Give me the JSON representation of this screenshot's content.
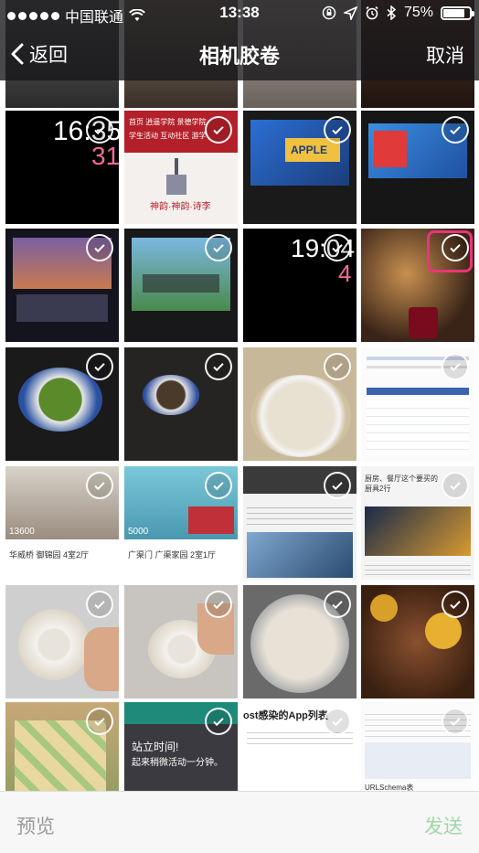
{
  "status_bar": {
    "carrier": "中国联通",
    "time": "13:38",
    "battery": "75%"
  },
  "nav": {
    "back_label": "返回",
    "title": "相机胶卷",
    "cancel_label": "取消"
  },
  "toolbar": {
    "preview_label": "预览",
    "send_label": "发送"
  },
  "photos": {
    "watch1_time": "16:35",
    "watch1_day": "31",
    "watch2_time": "19:04",
    "watch2_day": "4",
    "web_menu": "首页   逍遥学院   景德学院",
    "web_menu2": "学生活动   互动社区   游学",
    "web_caption": "神韵·神韵·诗李",
    "tv_brand": "APPLE",
    "house1_price": "13600",
    "house1_title": "华威桥  御锦园  4室2厅",
    "house2_price": "5000",
    "house2_title": "广渠门  广渠家园  2室1厅",
    "article_heading": "厨房、餐厅这个要买的厨具2行",
    "standup_title": "站立时间!",
    "standup_body": "起来稍微活动一分钟。",
    "app_list_title": "ost感染的App列表",
    "doc_caption": "URLSchema表"
  },
  "colors": {
    "bar_bg": "#16161a",
    "highlight": "#e9357a",
    "send_disabled": "#9fd8a8",
    "preview_disabled": "#9a9a9a"
  }
}
